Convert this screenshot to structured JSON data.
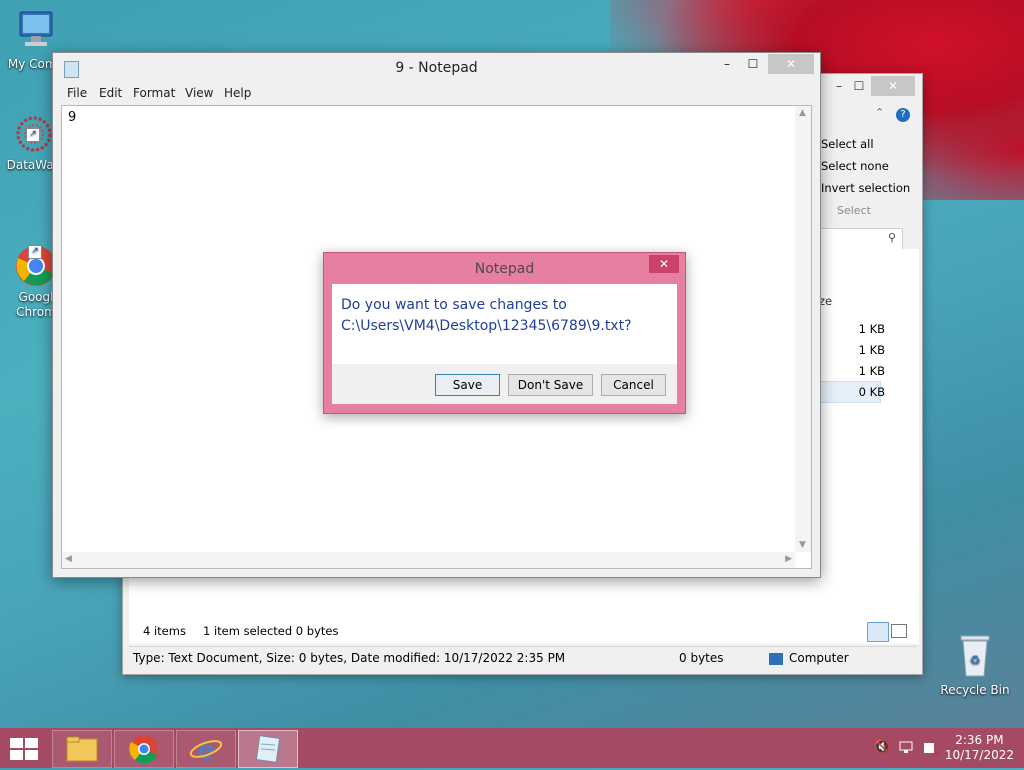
{
  "desktop": {
    "icons": [
      {
        "label": "My Comp"
      },
      {
        "label": "DataWag"
      },
      {
        "label": "Googl\nChrom"
      },
      {
        "label": "Recycle Bin"
      }
    ]
  },
  "explorer": {
    "minimize": "–",
    "maximize": "☐",
    "close": "✕",
    "ribbon": {
      "select_all": "Select all",
      "select_none": "Select none",
      "invert_selection": "Invert selection",
      "group_label": "Select"
    },
    "size_header": "ze",
    "sizes": [
      "1 KB",
      "1 KB",
      "1 KB",
      "0 KB"
    ],
    "status": {
      "items": "4 items",
      "selected": "1 item selected  0 bytes",
      "details": "Type: Text Document, Size: 0 bytes, Date modified: 10/17/2022 2:35 PM",
      "size": "0 bytes",
      "location": "Computer"
    }
  },
  "notepad": {
    "title": "9 - Notepad",
    "minimize": "–",
    "maximize": "☐",
    "close": "✕",
    "menu": [
      "File",
      "Edit",
      "Format",
      "View",
      "Help"
    ],
    "content": "9"
  },
  "dialog": {
    "title": "Notepad",
    "close": "✕",
    "message_line1": "Do you want to save changes to",
    "message_line2": "C:\\Users\\VM4\\Desktop\\12345\\6789\\9.txt?",
    "buttons": {
      "save": "Save",
      "dont_save": "Don't Save",
      "cancel": "Cancel"
    }
  },
  "taskbar": {
    "time": "2:36 PM",
    "date": "10/17/2022"
  }
}
